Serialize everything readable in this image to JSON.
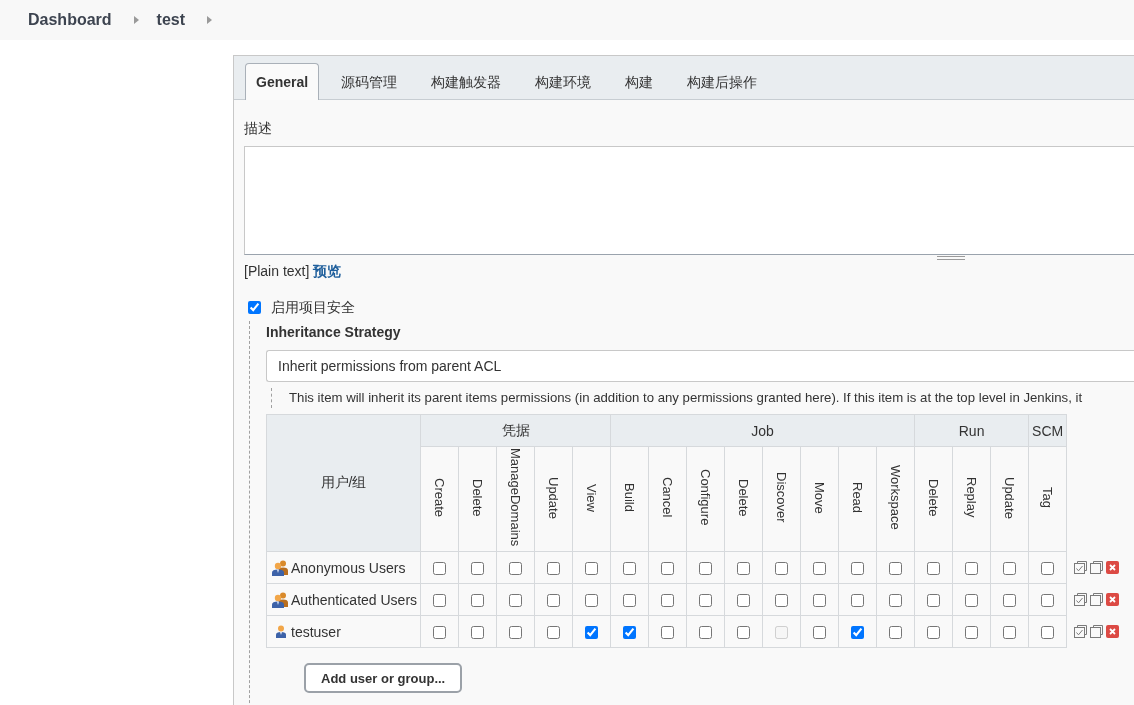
{
  "breadcrumbs": [
    {
      "label": "Dashboard"
    },
    {
      "label": "test"
    }
  ],
  "tabs": [
    {
      "label": "General",
      "selected": true
    },
    {
      "label": "源码管理",
      "selected": false
    },
    {
      "label": "构建触发器",
      "selected": false
    },
    {
      "label": "构建环境",
      "selected": false
    },
    {
      "label": "构建",
      "selected": false
    },
    {
      "label": "构建后操作",
      "selected": false
    }
  ],
  "description": {
    "label": "描述",
    "format": "[Plain text]",
    "preview_link": "预览"
  },
  "project_security": {
    "label": "启用项目安全",
    "checked": true
  },
  "inheritance": {
    "label": "Inheritance Strategy",
    "value": "Inherit permissions from parent ACL",
    "help": "This item will inherit its parent items permissions (in addition to any permissions granted here). If this item is at the top level in Jenkins, it"
  },
  "permissions": {
    "user_column": "用户/组",
    "groups": [
      {
        "name": "凭据",
        "permissions": [
          "Create",
          "Delete",
          "ManageDomains",
          "Update",
          "View"
        ]
      },
      {
        "name": "Job",
        "permissions": [
          "Build",
          "Cancel",
          "Configure",
          "Delete",
          "Discover",
          "Move",
          "Read",
          "Workspace"
        ]
      },
      {
        "name": "Run",
        "permissions": [
          "Delete",
          "Replay",
          "Update"
        ]
      },
      {
        "name": "SCM",
        "permissions": [
          "Tag"
        ]
      }
    ],
    "rows": [
      {
        "name": "Anonymous Users",
        "kind": "group",
        "cells": [
          {
            "checked": false,
            "disabled": false
          },
          {
            "checked": false,
            "disabled": false
          },
          {
            "checked": false,
            "disabled": false
          },
          {
            "checked": false,
            "disabled": false
          },
          {
            "checked": false,
            "disabled": false
          },
          {
            "checked": false,
            "disabled": false
          },
          {
            "checked": false,
            "disabled": false
          },
          {
            "checked": false,
            "disabled": false
          },
          {
            "checked": false,
            "disabled": false
          },
          {
            "checked": false,
            "disabled": false
          },
          {
            "checked": false,
            "disabled": false
          },
          {
            "checked": false,
            "disabled": false
          },
          {
            "checked": false,
            "disabled": false
          },
          {
            "checked": false,
            "disabled": false
          },
          {
            "checked": false,
            "disabled": false
          },
          {
            "checked": false,
            "disabled": false
          },
          {
            "checked": false,
            "disabled": false
          }
        ]
      },
      {
        "name": "Authenticated Users",
        "kind": "group",
        "cells": [
          {
            "checked": false,
            "disabled": false
          },
          {
            "checked": false,
            "disabled": false
          },
          {
            "checked": false,
            "disabled": false
          },
          {
            "checked": false,
            "disabled": false
          },
          {
            "checked": false,
            "disabled": false
          },
          {
            "checked": false,
            "disabled": false
          },
          {
            "checked": false,
            "disabled": false
          },
          {
            "checked": false,
            "disabled": false
          },
          {
            "checked": false,
            "disabled": false
          },
          {
            "checked": false,
            "disabled": false
          },
          {
            "checked": false,
            "disabled": false
          },
          {
            "checked": false,
            "disabled": false
          },
          {
            "checked": false,
            "disabled": false
          },
          {
            "checked": false,
            "disabled": false
          },
          {
            "checked": false,
            "disabled": false
          },
          {
            "checked": false,
            "disabled": false
          },
          {
            "checked": false,
            "disabled": false
          }
        ]
      },
      {
        "name": "testuser",
        "kind": "user",
        "cells": [
          {
            "checked": false,
            "disabled": false
          },
          {
            "checked": false,
            "disabled": false
          },
          {
            "checked": false,
            "disabled": false
          },
          {
            "checked": false,
            "disabled": false
          },
          {
            "checked": true,
            "disabled": false
          },
          {
            "checked": true,
            "disabled": false
          },
          {
            "checked": false,
            "disabled": false
          },
          {
            "checked": false,
            "disabled": false
          },
          {
            "checked": false,
            "disabled": false
          },
          {
            "checked": false,
            "disabled": true
          },
          {
            "checked": false,
            "disabled": false
          },
          {
            "checked": true,
            "disabled": false
          },
          {
            "checked": false,
            "disabled": false
          },
          {
            "checked": false,
            "disabled": false
          },
          {
            "checked": false,
            "disabled": false
          },
          {
            "checked": false,
            "disabled": false
          },
          {
            "checked": false,
            "disabled": false
          }
        ]
      }
    ],
    "add_button": "Add user or group..."
  }
}
